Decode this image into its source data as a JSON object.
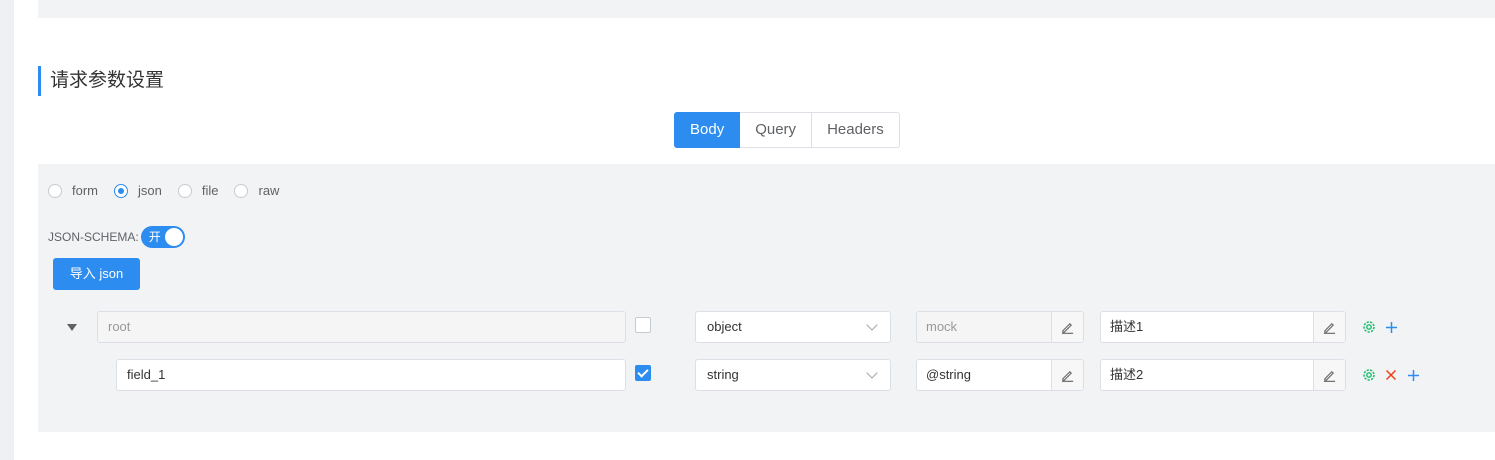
{
  "section": {
    "title": "请求参数设置"
  },
  "tabs": [
    {
      "label": "Body",
      "active": true
    },
    {
      "label": "Query",
      "active": false
    },
    {
      "label": "Headers",
      "active": false
    }
  ],
  "body_types": [
    {
      "label": "form",
      "checked": false
    },
    {
      "label": "json",
      "checked": true
    },
    {
      "label": "file",
      "checked": false
    },
    {
      "label": "raw",
      "checked": false
    }
  ],
  "json_schema": {
    "label": "JSON-SCHEMA:",
    "switch_text": "开",
    "enabled": true
  },
  "import_button": {
    "label": "导入 json"
  },
  "rows": [
    {
      "name": "root",
      "required": false,
      "type": "object",
      "mock": "mock",
      "mock_is_placeholder": true,
      "description": "描述1",
      "actions": [
        "settings-icon",
        "plus-icon"
      ]
    },
    {
      "name": "field_1",
      "required": true,
      "type": "string",
      "mock": "@string",
      "mock_is_placeholder": false,
      "description": "描述2",
      "actions": [
        "settings-icon",
        "close-icon",
        "plus-icon"
      ]
    }
  ],
  "colors": {
    "accent": "#2d8cf0",
    "settings": "#19be6b",
    "delete": "#ed4014",
    "panel": "#f2f3f5"
  }
}
